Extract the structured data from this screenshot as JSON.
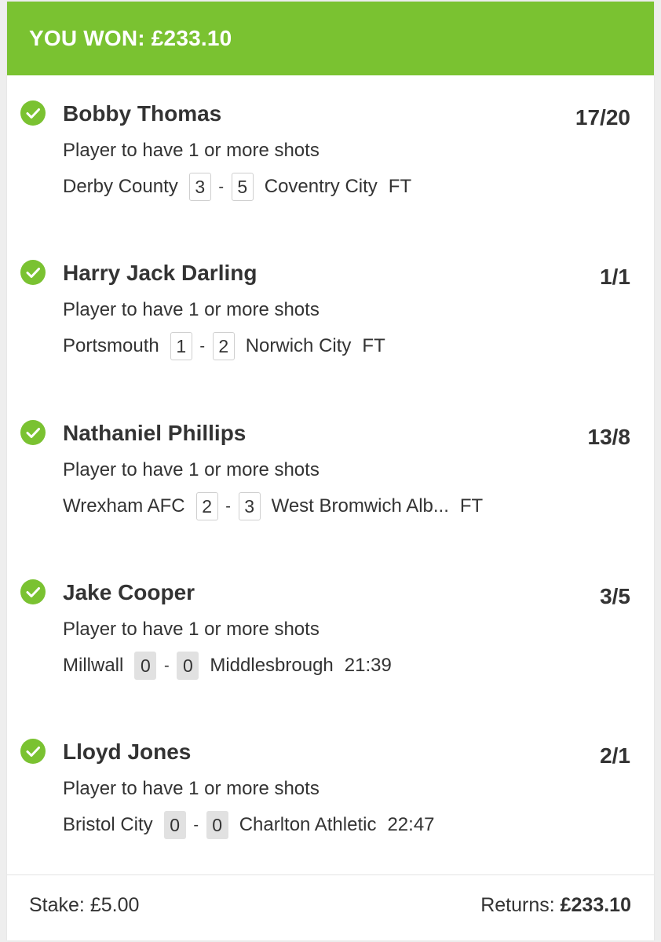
{
  "banner": {
    "text": "YOU WON: £233.10"
  },
  "selections": [
    {
      "player": "Bobby Thomas",
      "odds": "17/20",
      "market": "Player to have 1 or more shots",
      "home_team": "Derby County",
      "home_score": "3",
      "separator": "-",
      "away_score": "5",
      "away_team": "Coventry City",
      "status": "FT",
      "live": false
    },
    {
      "player": "Harry Jack Darling",
      "odds": "1/1",
      "market": "Player to have 1 or more shots",
      "home_team": "Portsmouth",
      "home_score": "1",
      "separator": "-",
      "away_score": "2",
      "away_team": "Norwich City",
      "status": "FT",
      "live": false
    },
    {
      "player": "Nathaniel Phillips",
      "odds": "13/8",
      "market": "Player to have 1 or more shots",
      "home_team": "Wrexham AFC",
      "home_score": "2",
      "separator": "-",
      "away_score": "3",
      "away_team": "West Bromwich Alb...",
      "status": "FT",
      "live": false
    },
    {
      "player": "Jake Cooper",
      "odds": "3/5",
      "market": "Player to have 1 or more shots",
      "home_team": "Millwall",
      "home_score": "0",
      "separator": "-",
      "away_score": "0",
      "away_team": "Middlesbrough",
      "status": "21:39",
      "live": true
    },
    {
      "player": "Lloyd Jones",
      "odds": "2/1",
      "market": "Player to have 1 or more shots",
      "home_team": "Bristol City",
      "home_score": "0",
      "separator": "-",
      "away_score": "0",
      "away_team": "Charlton Athletic",
      "status": "22:47",
      "live": true
    }
  ],
  "footer": {
    "stake_label": "Stake: £5.00",
    "returns_label": "Returns:",
    "returns_value": "£233.10"
  },
  "colors": {
    "accent_green": "#7ac231",
    "text": "#333333",
    "live_score_bg": "#e1e1e1"
  },
  "icons": {
    "selection_status": "check-circle-icon"
  }
}
